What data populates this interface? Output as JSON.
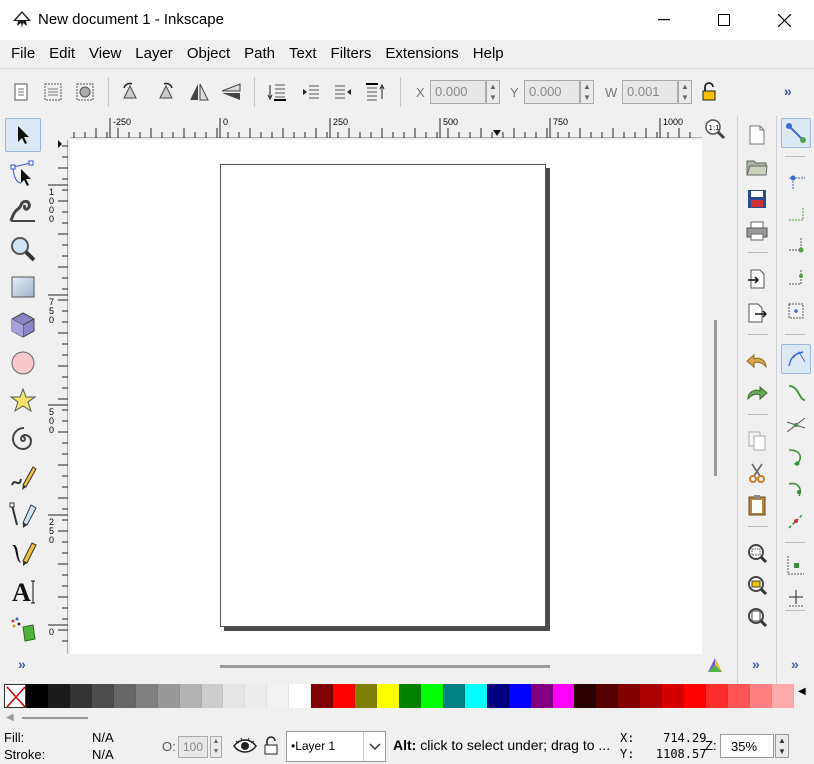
{
  "window": {
    "title": "New document 1 - Inkscape",
    "minimize": "—",
    "maximize": "☐",
    "close": "✕"
  },
  "menu": [
    "File",
    "Edit",
    "View",
    "Layer",
    "Object",
    "Path",
    "Text",
    "Filters",
    "Extensions",
    "Help"
  ],
  "commandbar": {
    "x_label": "X",
    "x_value": "0.000",
    "y_label": "Y",
    "y_value": "0.000",
    "w_label": "W",
    "w_value": "0.001",
    "more": "»"
  },
  "rulers": {
    "h_labels": [
      "-250",
      "0",
      "250",
      "500",
      "750",
      "1000"
    ],
    "v_labels": [
      "1000",
      "750",
      "500",
      "250",
      "0"
    ]
  },
  "palette": {
    "colors": [
      "#000000",
      "#1a1a1a",
      "#333333",
      "#4d4d4d",
      "#666666",
      "#808080",
      "#999999",
      "#b3b3b3",
      "#cccccc",
      "#e6e6e6",
      "#ececec",
      "#f2f2f2",
      "#ffffff",
      "#800000",
      "#ff0000",
      "#808000",
      "#ffff00",
      "#008000",
      "#00ff00",
      "#008080",
      "#00ffff",
      "#000080",
      "#0000ff",
      "#800080",
      "#ff00ff",
      "#2b0000",
      "#550000",
      "#800000",
      "#aa0000",
      "#d40000",
      "#ff0000",
      "#ff2a2a",
      "#ff5555",
      "#ff8080",
      "#ffaaaa"
    ]
  },
  "status": {
    "fill_label": "Fill:",
    "fill_value": "N/A",
    "stroke_label": "Stroke:",
    "stroke_value": "N/A",
    "opacity_label": "O:",
    "opacity_value": "100",
    "layer_name": "•Layer 1",
    "message_bold": "Alt:",
    "message": " click to select under; drag to ...",
    "x_label": "X:",
    "x_value": "714.29",
    "y_label": "Y:",
    "y_value": "1108.57",
    "zoom_label": "Z:",
    "zoom_value": "35%"
  },
  "more_label": "»"
}
